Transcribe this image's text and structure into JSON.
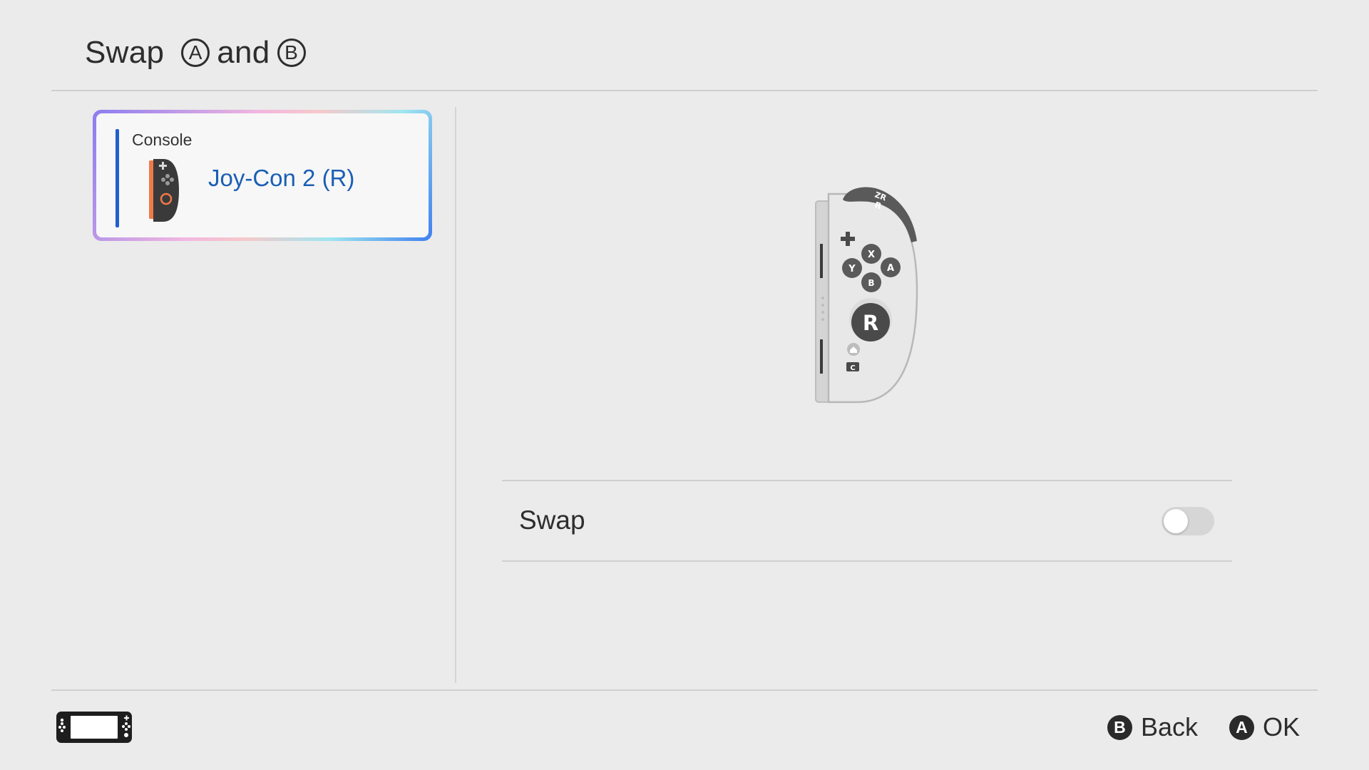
{
  "header": {
    "title_prefix": "Swap",
    "title_glyph_a": "A",
    "title_middle": "and",
    "title_glyph_b": "B"
  },
  "controller_card": {
    "group_label": "Console",
    "name": "Joy-Con 2 (R)",
    "icon": "joycon-right-icon",
    "selected": true
  },
  "illustration": {
    "icon": "joycon-right-large-icon",
    "button_labels": {
      "zr": "ZR",
      "r": "R",
      "x": "X",
      "y": "Y",
      "a": "A",
      "b": "B",
      "stick": "R",
      "c": "C"
    }
  },
  "setting": {
    "label": "Swap",
    "enabled": false
  },
  "footer": {
    "console_icon": "console-icon",
    "actions": [
      {
        "glyph": "B",
        "label": "Back"
      },
      {
        "glyph": "A",
        "label": "OK"
      }
    ]
  },
  "colors": {
    "background": "#ebebeb",
    "accent_blue": "#1a5fb4",
    "joycon_orange": "#f07a4a",
    "toggle_off": "#d6d6d6"
  }
}
